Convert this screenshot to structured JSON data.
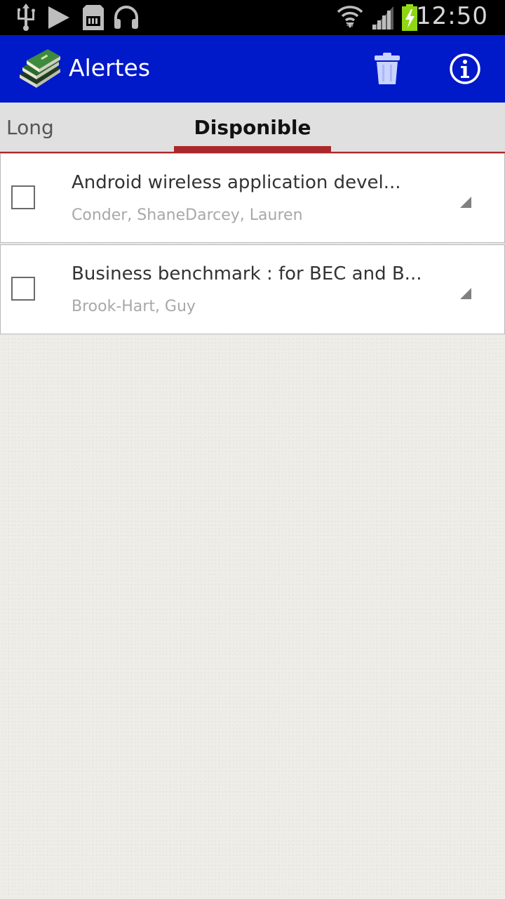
{
  "status_bar": {
    "time": "12:50",
    "icons": [
      "usb-icon",
      "play-store-icon",
      "sd-card-icon",
      "headphones-icon",
      "wifi-icon",
      "signal-icon",
      "battery-charging-icon"
    ]
  },
  "action_bar": {
    "title": "Alertes",
    "app_icon": "books-icon",
    "actions": [
      "trash-icon",
      "info-icon"
    ],
    "color": "#0019c9"
  },
  "tabs": {
    "items": [
      {
        "label": "Long",
        "selected": false
      },
      {
        "label": "Disponible",
        "selected": true
      }
    ],
    "indicator_color": "#a9292b"
  },
  "list": {
    "items": [
      {
        "title": "Android wireless application devel...",
        "author": "Conder, ShaneDarcey, Lauren",
        "checked": false
      },
      {
        "title": "Business benchmark : for BEC and B...",
        "author": "Brook-Hart, Guy",
        "checked": false
      }
    ]
  }
}
